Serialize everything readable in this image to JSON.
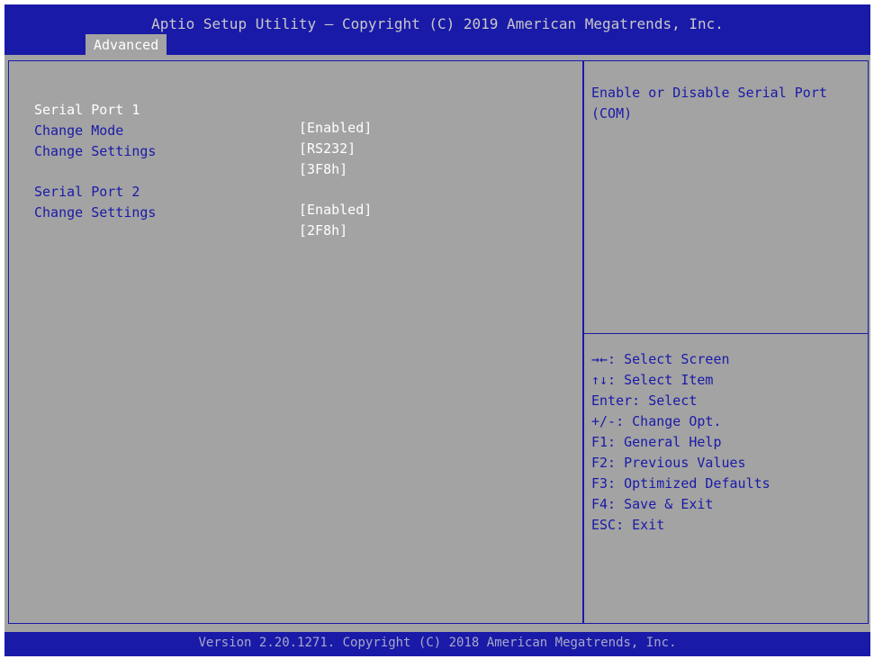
{
  "header": {
    "title": "Aptio Setup Utility – Copyright (C) 2019 American Megatrends, Inc.",
    "tab": "Advanced"
  },
  "settings": [
    {
      "label": "Serial Port 1",
      "value": "[Enabled]"
    },
    {
      "label": "Change Mode",
      "value": "[RS232]"
    },
    {
      "label": "Change Settings",
      "value": "[3F8h]"
    },
    {
      "label": "Serial Port 2",
      "value": "[Enabled]"
    },
    {
      "label": "Change Settings",
      "value": "[2F8h]"
    }
  ],
  "help_text": "Enable or Disable Serial Port (COM)",
  "keys": [
    "→←: Select Screen",
    "↑↓: Select Item",
    "Enter: Select",
    "+/-: Change Opt.",
    "F1: General Help",
    "F2: Previous Values",
    "F3: Optimized Defaults",
    "F4: Save & Exit",
    "ESC: Exit"
  ],
  "footer": "Version 2.20.1271. Copyright (C) 2018 American Megatrends, Inc.",
  "colors": {
    "bar_blue": "#1a1aa8",
    "panel_gray": "#a3a3a3",
    "text_blue": "#1a1aa8",
    "text_white": "#ffffff"
  }
}
